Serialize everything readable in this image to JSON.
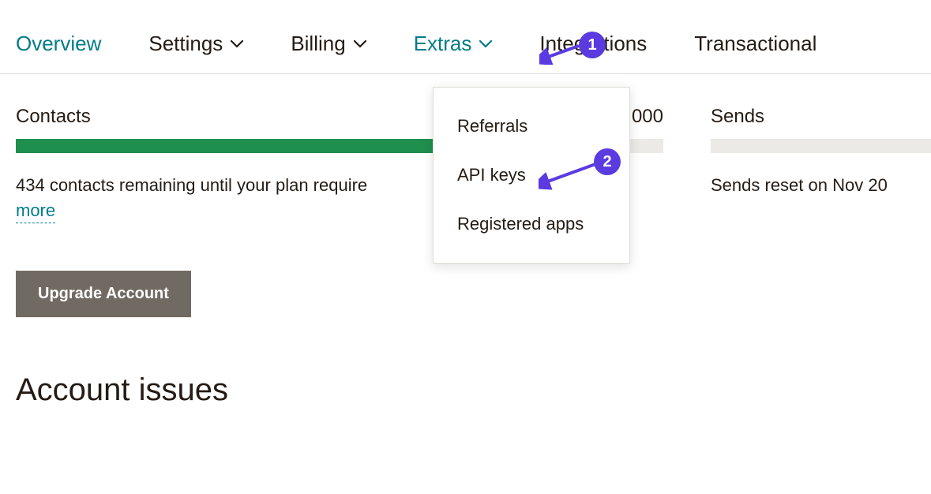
{
  "tabs": {
    "overview": "Overview",
    "settings": "Settings",
    "billing": "Billing",
    "extras": "Extras",
    "integrations": "Integrations",
    "transactional": "Transactional"
  },
  "dropdown": {
    "referrals": "Referrals",
    "api_keys": "API keys",
    "registered_apps": "Registered apps"
  },
  "contacts": {
    "label": "Contacts",
    "value_partial": "000",
    "note": "434 contacts remaining until your plan require",
    "learn_more": "more",
    "fill_percent": 65
  },
  "sends": {
    "label": "Sends",
    "note": "Sends reset on Nov 20"
  },
  "upgrade_button": "Upgrade Account",
  "section_heading": "Account issues",
  "annotations": {
    "one": "1",
    "two": "2"
  }
}
